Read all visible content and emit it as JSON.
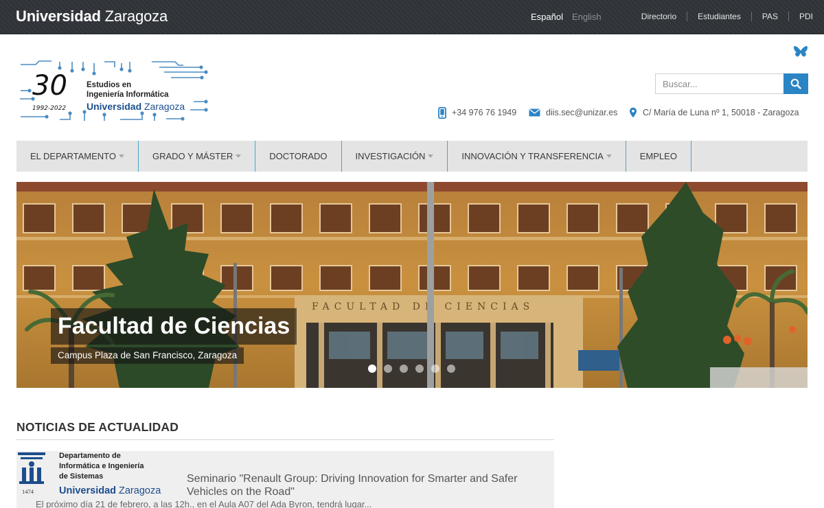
{
  "topbar": {
    "brand_bold": "Universidad",
    "brand_rest": "Zaragoza",
    "lang_active": "Español",
    "lang_other": "English",
    "links": [
      "Directorio",
      "Estudiantes",
      "PAS",
      "PDI"
    ]
  },
  "logo": {
    "number": "30",
    "years": "1992-2022",
    "line1": "Estudios en",
    "line2": "Ingeniería Informática",
    "uni_bold": "Universidad",
    "uni_rest": "Zaragoza"
  },
  "search": {
    "placeholder": "Buscar..."
  },
  "contact": {
    "phone": "+34 976 76 1949",
    "email": "diis.sec@unizar.es",
    "address": "C/ María de Luna nº 1, 50018 - Zaragoza"
  },
  "nav": {
    "items": [
      {
        "label": "EL DEPARTAMENTO",
        "dropdown": true
      },
      {
        "label": "GRADO Y MÁSTER",
        "dropdown": true
      },
      {
        "label": "DOCTORADO",
        "dropdown": false
      },
      {
        "label": "INVESTIGACIÓN",
        "dropdown": true
      },
      {
        "label": "INNOVACIÓN Y TRANSFERENCIA",
        "dropdown": true
      },
      {
        "label": "EMPLEO",
        "dropdown": false
      }
    ]
  },
  "hero": {
    "title": "Facultad de Ciencias",
    "subtitle": "Campus Plaza de San Francisco, Zaragoza",
    "facade_text": "FACULTAD DE CIENCIAS",
    "slides": 6,
    "active_slide": 1
  },
  "news": {
    "heading": "NOTICIAS DE ACTUALIDAD",
    "dept_logo": {
      "line1": "Departamento de",
      "line2": "Informática e Ingeniería",
      "line3": "de Sistemas",
      "year": "1474",
      "uni_bold": "Universidad",
      "uni_rest": "Zaragoza"
    },
    "item_title": "Seminario \"Renault Group: Driving Innovation for Smarter and Safer Vehicles on the Road\"",
    "item_excerpt": "El próximo día 21 de febrero, a las 12h., en el Aula A07 del Ada Byron, tendrá lugar..."
  },
  "colors": {
    "accent": "#2b84c4",
    "topbar": "#2f3338",
    "nav_bg": "#e4e4e4",
    "nav_divider": "#4aa3c9"
  },
  "icons": [
    "bluesky-icon",
    "search-icon",
    "phone-icon",
    "mail-icon",
    "location-pin-icon"
  ]
}
